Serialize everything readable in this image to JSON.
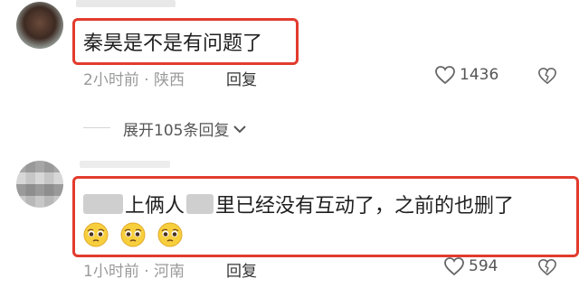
{
  "comments": [
    {
      "text": "秦昊是不是有问题了",
      "time": "2小时前",
      "location": "陕西",
      "reply_label": "回复",
      "likes": "1436"
    },
    {
      "text_visible": "上俩人",
      "text_rest": "里已经没有互动了，之前的也删了",
      "time": "1小时前",
      "location": "河南",
      "reply_label": "回复",
      "likes": "594",
      "emojis": [
        "pleading-face",
        "pleading-face",
        "pleading-face"
      ]
    }
  ],
  "expand_replies": "展开105条回复",
  "colors": {
    "highlight_border": "#e23b2e",
    "meta_text": "#9a9a9a"
  }
}
